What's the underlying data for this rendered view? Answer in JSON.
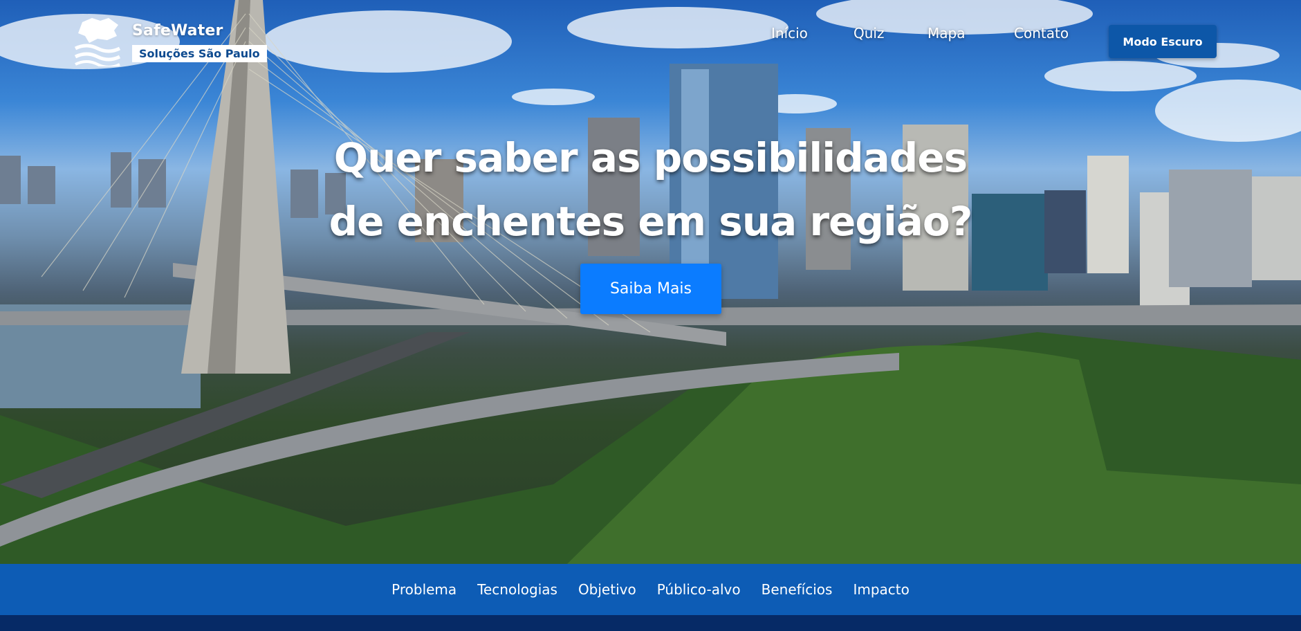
{
  "brand": {
    "name": "SafeWater",
    "tagline": "Soluções São Paulo",
    "logo_icon": "sao-paulo-map-waves-icon"
  },
  "nav": {
    "items": [
      {
        "label": "Início"
      },
      {
        "label": "Quiz"
      },
      {
        "label": "Mapa"
      },
      {
        "label": "Contato"
      }
    ],
    "dark_mode_label": "Modo Escuro"
  },
  "hero": {
    "headline_line1": "Quer saber as possibilidades",
    "headline_line2": "de enchentes em sua região?",
    "cta_label": "Saiba Mais"
  },
  "subnav": {
    "items": [
      {
        "label": "Problema"
      },
      {
        "label": "Tecnologias"
      },
      {
        "label": "Objetivo"
      },
      {
        "label": "Público-alvo"
      },
      {
        "label": "Benefícios"
      },
      {
        "label": "Impacto"
      }
    ]
  },
  "colors": {
    "primary": "#0d5cb5",
    "cta": "#0b7cff",
    "footer": "#062a66"
  }
}
